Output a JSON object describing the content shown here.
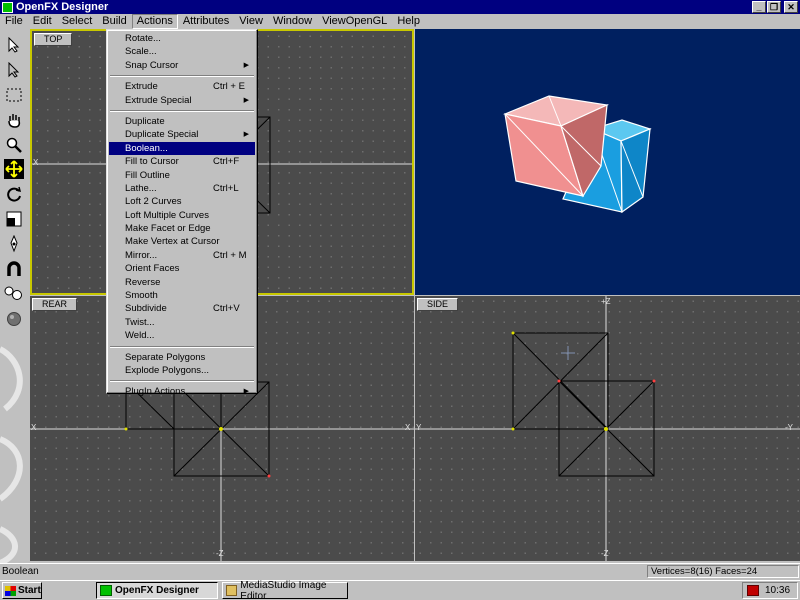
{
  "window": {
    "title": "OpenFX Designer",
    "buttons": {
      "minimize": "_",
      "restore": "❐",
      "close": "✕"
    }
  },
  "menubar": {
    "items": [
      "File",
      "Edit",
      "Select",
      "Build",
      "Actions",
      "Attributes",
      "View",
      "Window",
      "ViewOpenGL",
      "Help"
    ],
    "active": "Actions"
  },
  "actions_menu": {
    "groups": [
      [
        {
          "label": "Rotate...",
          "shortcut": "",
          "submenu": false
        },
        {
          "label": "Scale...",
          "shortcut": "",
          "submenu": false
        },
        {
          "label": "Snap Cursor",
          "shortcut": "",
          "submenu": true
        }
      ],
      [
        {
          "label": "Extrude",
          "shortcut": "Ctrl + E",
          "submenu": false
        },
        {
          "label": "Extrude Special",
          "shortcut": "",
          "submenu": true
        }
      ],
      [
        {
          "label": "Duplicate",
          "shortcut": "",
          "submenu": false
        },
        {
          "label": "Duplicate Special",
          "shortcut": "",
          "submenu": true
        },
        {
          "label": "Boolean...",
          "shortcut": "",
          "submenu": false,
          "highlighted": true
        },
        {
          "label": "Fill to Cursor",
          "shortcut": "Ctrl+F",
          "submenu": false
        },
        {
          "label": "Fill Outline",
          "shortcut": "",
          "submenu": false
        },
        {
          "label": "Lathe...",
          "shortcut": "Ctrl+L",
          "submenu": false
        },
        {
          "label": "Loft 2 Curves",
          "shortcut": "",
          "submenu": false
        },
        {
          "label": "Loft Multiple Curves",
          "shortcut": "",
          "submenu": false
        },
        {
          "label": "Make Facet or Edge",
          "shortcut": "",
          "submenu": false
        },
        {
          "label": "Make Vertex at Cursor",
          "shortcut": "",
          "submenu": false
        },
        {
          "label": "Mirror...",
          "shortcut": "Ctrl + M",
          "submenu": false
        },
        {
          "label": "Orient Faces",
          "shortcut": "",
          "submenu": false
        },
        {
          "label": "Reverse",
          "shortcut": "",
          "submenu": false
        },
        {
          "label": "Smooth",
          "shortcut": "",
          "submenu": false
        },
        {
          "label": "Subdivide",
          "shortcut": "Ctrl+V",
          "submenu": false
        },
        {
          "label": "Twist...",
          "shortcut": "",
          "submenu": false
        },
        {
          "label": "Weld...",
          "shortcut": "",
          "submenu": false
        }
      ],
      [
        {
          "label": "Separate Polygons",
          "shortcut": "",
          "submenu": false
        },
        {
          "label": "Explode Polygons...",
          "shortcut": "",
          "submenu": false
        }
      ],
      [
        {
          "label": "PlugIn Actions",
          "shortcut": "",
          "submenu": true
        }
      ]
    ]
  },
  "viewports": {
    "top": {
      "label": "TOP",
      "axis_x": "X",
      "axis_xr": "X"
    },
    "rear": {
      "label": "REAR",
      "axis_x": "X",
      "axis_xr": "X",
      "axis_z": "-Z"
    },
    "side": {
      "label": "SIDE",
      "axis_y": "Y",
      "axis_yr": "-Y",
      "axis_ztop": "+Z",
      "axis_z": "-Z"
    }
  },
  "tools": [
    "select-arrow-icon",
    "node-arrow-icon",
    "marquee-icon",
    "hand-icon",
    "zoom-icon",
    "move-icon",
    "rotate-icon",
    "scale-icon",
    "pen-icon",
    "magnet-icon",
    "spheres-icon",
    "ball-icon"
  ],
  "status": {
    "left": "Boolean",
    "right": "Vertices=8(16) Faces=24"
  },
  "taskbar": {
    "start": "Start",
    "tasks": [
      {
        "label": "OpenFX Designer",
        "pressed": true
      },
      {
        "label": "MediaStudio Image Editor",
        "pressed": false
      }
    ],
    "clock": "10:36"
  },
  "colors": {
    "titlebar": "#000080",
    "viewport_bg": "#4b4b4b",
    "perspective_bg": "#002060",
    "cube_pink": "#f09090",
    "cube_blue": "#1a9ee0",
    "active_viewport_border": "#c8c800"
  }
}
